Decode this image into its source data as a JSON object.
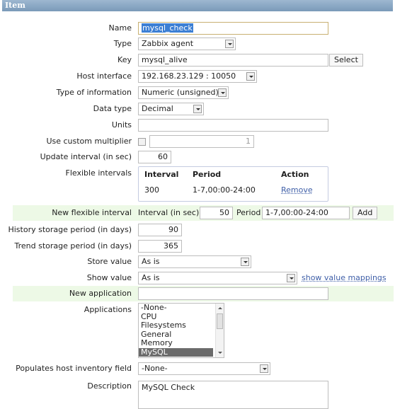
{
  "header": {
    "title": "Item"
  },
  "form": {
    "name": {
      "label": "Name",
      "value": "mysql_check"
    },
    "type": {
      "label": "Type",
      "value": "Zabbix agent"
    },
    "key": {
      "label": "Key",
      "value": "mysql_alive",
      "button": "Select"
    },
    "host_interface": {
      "label": "Host interface",
      "value": "192.168.23.129 : 10050"
    },
    "type_of_information": {
      "label": "Type of information",
      "value": "Numeric (unsigned)"
    },
    "data_type": {
      "label": "Data type",
      "value": "Decimal"
    },
    "units": {
      "label": "Units",
      "value": ""
    },
    "custom_multiplier": {
      "label": "Use custom multiplier",
      "checked": false,
      "value": "1"
    },
    "update_interval": {
      "label": "Update interval (in sec)",
      "value": "60"
    },
    "flexible_intervals": {
      "label": "Flexible intervals",
      "columns": [
        "Interval",
        "Period",
        "Action"
      ],
      "rows": [
        {
          "interval": "300",
          "period": "1-7,00:00-24:00",
          "action": "Remove"
        }
      ]
    },
    "new_flexible_interval": {
      "label": "New flexible interval",
      "interval_label": "Interval (in sec)",
      "interval_value": "50",
      "period_label": "Period",
      "period_value": "1-7,00:00-24:00",
      "button": "Add"
    },
    "history": {
      "label": "History storage period (in days)",
      "value": "90"
    },
    "trends": {
      "label": "Trend storage period (in days)",
      "value": "365"
    },
    "store_value": {
      "label": "Store value",
      "value": "As is"
    },
    "show_value": {
      "label": "Show value",
      "value": "As is",
      "link": "show value mappings"
    },
    "new_application": {
      "label": "New application",
      "value": ""
    },
    "applications": {
      "label": "Applications",
      "options": [
        "-None-",
        "CPU",
        "Filesystems",
        "General",
        "Memory",
        "MySQL"
      ],
      "selected": "MySQL"
    },
    "inventory": {
      "label": "Populates host inventory field",
      "value": "-None-"
    },
    "description": {
      "label": "Description",
      "value": "MySQL Check"
    }
  },
  "colors": {
    "header_bg": "#7a9ab9",
    "highlight_row": "#edf9e6",
    "link": "#3f5fa8",
    "selected_option": "#6b6b6b"
  }
}
